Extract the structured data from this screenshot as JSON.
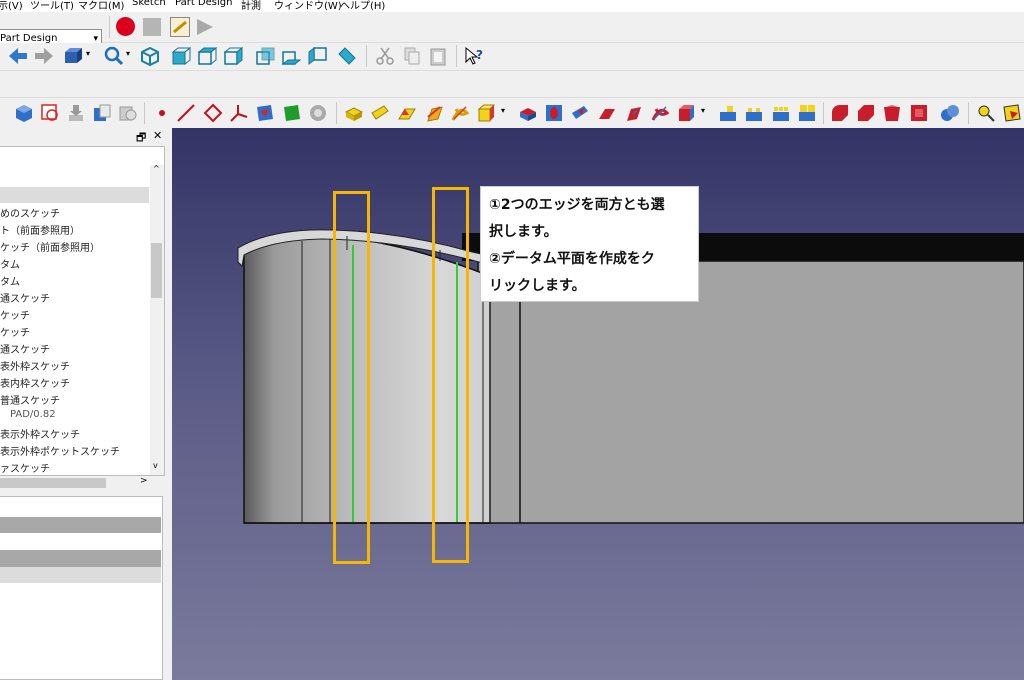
{
  "menubar": {
    "items": [
      "示(V)",
      "ツール(T)",
      "マクロ(M)",
      "Sketch",
      "Part Design",
      "計測",
      "ウィンドウ(W)",
      "ヘルプ(H)"
    ]
  },
  "workbench": {
    "selected": "Part Design"
  },
  "combo_view": {
    "float_icon": "🗗",
    "close_icon": "✕",
    "tree_items": [
      "",
      "めのスケッチ",
      "ト（前面参照用）",
      "ケッチ（前面参照用）",
      "タム",
      "タム",
      "通スケッチ",
      "ケッチ",
      "ケッチ",
      "通スケッチ",
      "表外枠スケッチ",
      "表内枠スケッチ",
      "普通スケッチ",
      "PAD/0.82",
      "表示外枠スケッチ",
      "表示外枠ポケットスケッチ",
      "ァスケッチ"
    ],
    "scroll_up": "^",
    "scroll_down": "v",
    "scroll_right": ">"
  },
  "callout": {
    "line1": "①2つのエッジを両方とも選",
    "line2": "択します。",
    "line3": "②データム平面を作成をク",
    "line4": "リックします。"
  },
  "colors": {
    "highlight": "#f5b700",
    "edge_selected": "#33cc33",
    "view_top": "#333366",
    "view_bottom": "#7b7b9d"
  }
}
